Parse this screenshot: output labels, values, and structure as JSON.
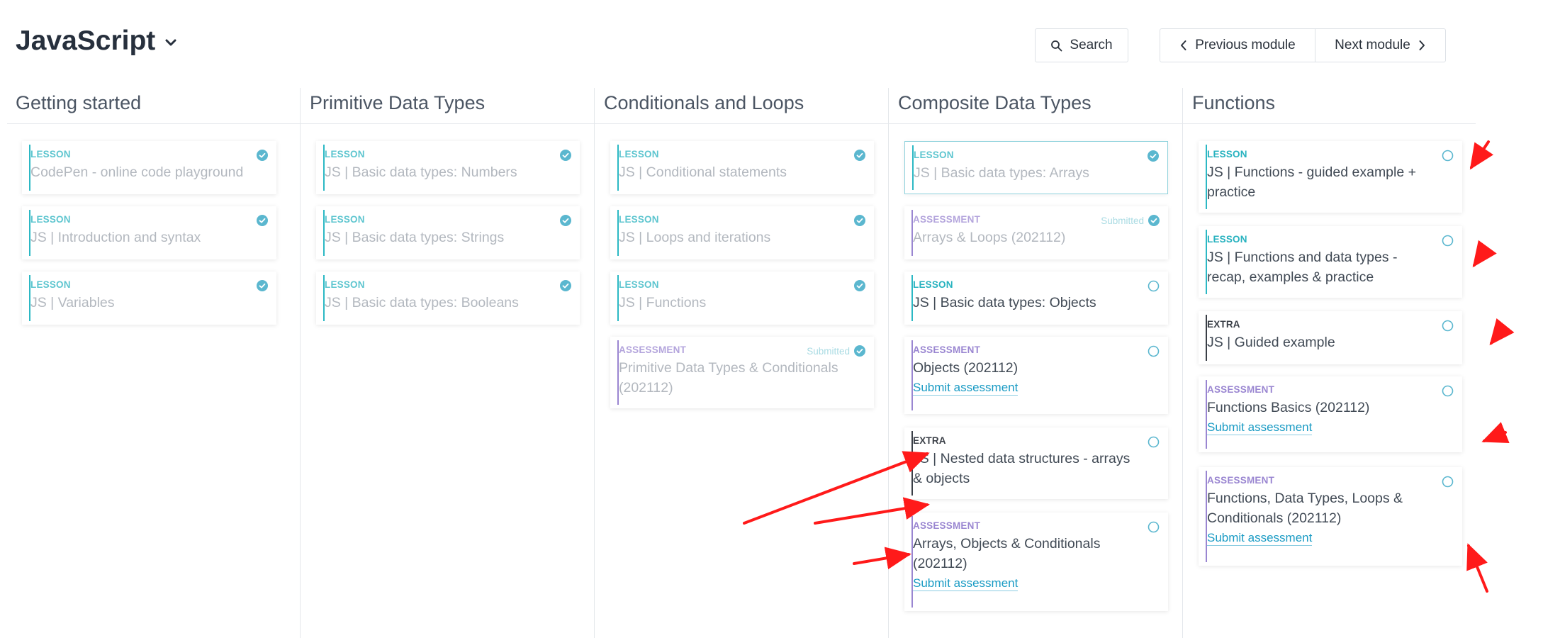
{
  "header": {
    "course_title": "JavaScript",
    "search_label": "Search",
    "prev_label": "Previous module",
    "next_label": "Next module"
  },
  "colors": {
    "lesson": "#2cb8c4",
    "assessment": "#9a86d1",
    "extra": "#3a3f47",
    "check": "#5bb7cf",
    "link": "#1a9bc4",
    "annotation_arrow": "#ff1a1a"
  },
  "columns": [
    {
      "title": "Getting started",
      "cards": [
        {
          "type": "LESSON",
          "title": "CodePen - online code playground",
          "status": "check-icon"
        },
        {
          "type": "LESSON",
          "title": "JS | Introduction and syntax",
          "status": "check-icon"
        },
        {
          "type": "LESSON",
          "title": "JS | Variables",
          "status": "check-icon"
        }
      ]
    },
    {
      "title": "Primitive Data Types",
      "cards": [
        {
          "type": "LESSON",
          "title": "JS | Basic data types: Numbers",
          "status": "check-icon"
        },
        {
          "type": "LESSON",
          "title": "JS | Basic data types: Strings",
          "status": "check-icon"
        },
        {
          "type": "LESSON",
          "title": "JS | Basic data types: Booleans",
          "status": "check-icon"
        }
      ]
    },
    {
      "title": "Conditionals and Loops",
      "cards": [
        {
          "type": "LESSON",
          "title": "JS | Conditional statements",
          "status": "check-icon"
        },
        {
          "type": "LESSON",
          "title": "JS | Loops and iterations",
          "status": "check-icon"
        },
        {
          "type": "LESSON",
          "title": "JS | Functions",
          "status": "check-icon"
        },
        {
          "type": "ASSESSMENT",
          "title": "Primitive Data Types & Conditionals (202112)",
          "status": "check-icon",
          "status_label": "Submitted"
        }
      ]
    },
    {
      "title": "Composite Data Types",
      "cards": [
        {
          "type": "LESSON",
          "title": "JS | Basic data types: Arrays",
          "status": "check-icon"
        },
        {
          "type": "ASSESSMENT",
          "title": "Arrays & Loops (202112)",
          "status": "check-icon",
          "status_label": "Submitted"
        },
        {
          "type": "LESSON",
          "title": "JS | Basic data types: Objects",
          "status": "circle-icon"
        },
        {
          "type": "ASSESSMENT",
          "title": "Objects (202112)",
          "status": "circle-icon",
          "action": "Submit assessment"
        },
        {
          "type": "EXTRA",
          "title": "JS | Nested data structures - arrays & objects",
          "status": "circle-icon"
        },
        {
          "type": "ASSESSMENT",
          "title": "Arrays, Objects & Conditionals (202112)",
          "status": "circle-icon",
          "action": "Submit assessment"
        }
      ]
    },
    {
      "title": "Functions",
      "cards": [
        {
          "type": "LESSON",
          "title": "JS | Functions - guided example + practice",
          "status": "circle-icon"
        },
        {
          "type": "LESSON",
          "title": "JS | Functions and data types - recap, examples & practice",
          "status": "circle-icon"
        },
        {
          "type": "EXTRA",
          "title": "JS | Guided example",
          "status": "circle-icon"
        },
        {
          "type": "ASSESSMENT",
          "title": "Functions Basics (202112)",
          "status": "circle-icon",
          "action": "Submit assessment"
        },
        {
          "type": "ASSESSMENT",
          "title": "Functions, Data Types, Loops & Conditionals (202112)",
          "status": "circle-icon",
          "action": "Submit assessment"
        }
      ]
    }
  ]
}
